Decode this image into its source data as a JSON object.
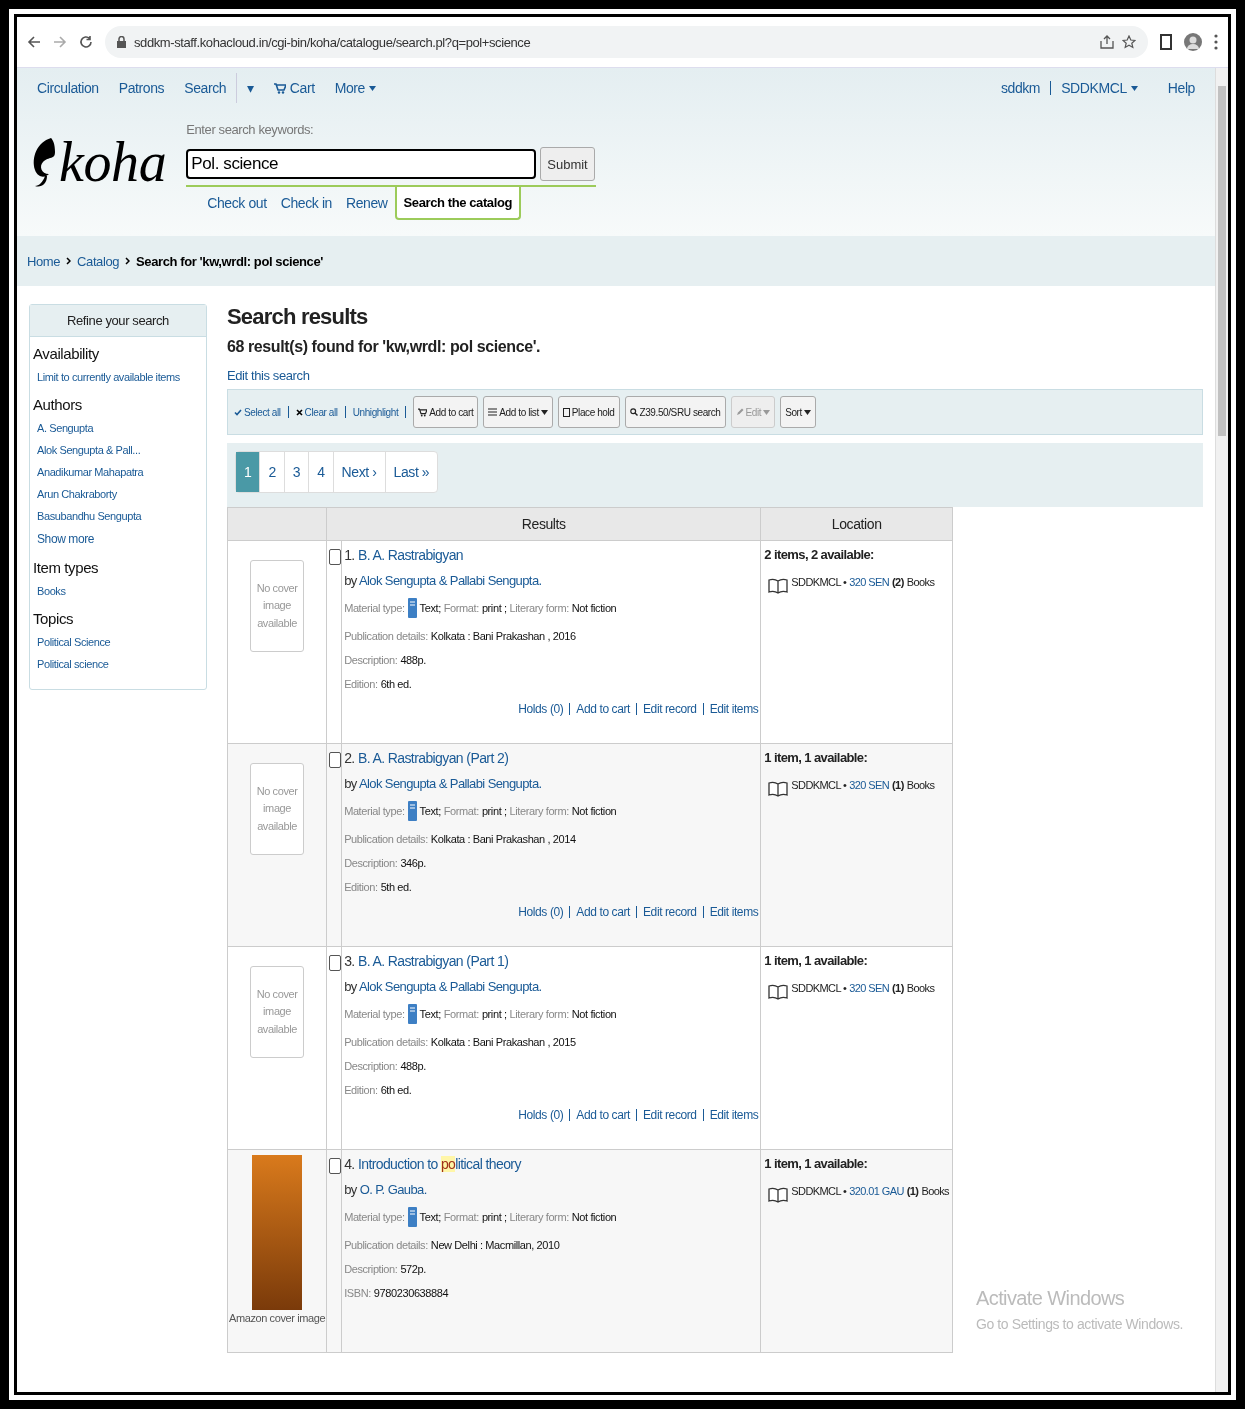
{
  "browser": {
    "url": "sddkm-staff.kohacloud.in/cgi-bin/koha/catalogue/search.pl?q=pol+science"
  },
  "nav": {
    "left": [
      {
        "label": "Circulation",
        "kind": "link"
      },
      {
        "label": "Patrons",
        "kind": "link"
      },
      {
        "label": "Search",
        "kind": "link"
      },
      {
        "label": "▾",
        "kind": "toggle"
      },
      {
        "label": "Cart",
        "kind": "cart"
      },
      {
        "label": "More",
        "kind": "menu"
      }
    ],
    "right": [
      {
        "label": "sddkm",
        "kind": "link"
      },
      {
        "label": "SDDKMCL",
        "kind": "menu"
      },
      {
        "label": "Help",
        "kind": "link"
      }
    ]
  },
  "header": {
    "logo": "koha",
    "search_label": "Enter search keywords:",
    "search_value": "Pol. science",
    "submit": "Submit",
    "tabs": [
      {
        "label": "Check out",
        "selected": false
      },
      {
        "label": "Check in",
        "selected": false
      },
      {
        "label": "Renew",
        "selected": false
      },
      {
        "label": "Search the catalog",
        "selected": true
      }
    ]
  },
  "breadcrumb": [
    {
      "label": "Home",
      "link": true
    },
    {
      "label": "Catalog",
      "link": true
    },
    {
      "label": "Search for 'kw,wrdl: pol science'",
      "link": false
    }
  ],
  "sidebar": {
    "title": "Refine your search",
    "groups": [
      {
        "heading": "Availability",
        "items": [
          {
            "label": "Limit to currently available items",
            "kind": "link"
          }
        ]
      },
      {
        "heading": "Authors",
        "items": [
          {
            "label": "A. Sengupta",
            "kind": "link"
          },
          {
            "label": "Alok Sengupta & Pall...",
            "kind": "link"
          },
          {
            "label": "Anadikumar Mahapatra",
            "kind": "link"
          },
          {
            "label": "Arun Chakraborty",
            "kind": "link"
          },
          {
            "label": "Basubandhu Sengupta",
            "kind": "link"
          },
          {
            "label": "Show more",
            "kind": "more"
          }
        ]
      },
      {
        "heading": "Item types",
        "items": [
          {
            "label": "Books",
            "kind": "link"
          }
        ]
      },
      {
        "heading": "Topics",
        "items": [
          {
            "label": "Political Science",
            "kind": "link"
          },
          {
            "label": "Political science",
            "kind": "link"
          }
        ]
      }
    ]
  },
  "main": {
    "title": "Search results",
    "summary": "68 result(s) found for 'kw,wrdl: pol science'.",
    "edit_link": "Edit this search"
  },
  "toolbar": {
    "links": [
      {
        "label": "Select all",
        "kind": "check"
      },
      {
        "label": "Clear all",
        "kind": "cross"
      },
      {
        "label": "Unhighlight",
        "kind": "plain"
      }
    ],
    "buttons": [
      {
        "label": "Add to cart",
        "kind": "cart",
        "caret": false,
        "disabled": false
      },
      {
        "label": "Add to list",
        "kind": "list",
        "caret": true,
        "disabled": false
      },
      {
        "label": "Place hold",
        "kind": "doc",
        "caret": false,
        "disabled": false
      },
      {
        "label": "Z39.50/SRU search",
        "kind": "search",
        "caret": false,
        "disabled": false
      },
      {
        "label": "Edit",
        "kind": "pencil",
        "caret": true,
        "disabled": true
      },
      {
        "label": "Sort",
        "kind": "plain",
        "caret": true,
        "disabled": false
      }
    ]
  },
  "pagination": [
    {
      "label": "1",
      "selected": true
    },
    {
      "label": "2",
      "selected": false
    },
    {
      "label": "3",
      "selected": false
    },
    {
      "label": "4",
      "selected": false
    },
    {
      "label": "Next ›",
      "selected": false
    },
    {
      "label": "Last »",
      "selected": false
    }
  ],
  "table": {
    "columns": [
      "Results",
      "Location"
    ],
    "rows": [
      {
        "cover": {
          "kind": "none",
          "text": "No cover image available"
        },
        "checked": false,
        "number": "1.",
        "title": [
          {
            "text": "B. A. Rastrabigyan",
            "highlight": false
          }
        ],
        "by": "by",
        "author": "Alok Sengupta & Pallabi Sengupta.",
        "details": [
          [
            {
              "label": "Material type:",
              "value": "Text;",
              "kind": "material"
            },
            {
              "label": "Format:",
              "value": "print ;",
              "kind": "plain"
            },
            {
              "label": "Literary form:",
              "value": "Not fiction",
              "kind": "plain"
            }
          ],
          [
            {
              "label": "Publication details:",
              "value": "Kolkata : Bani Prakashan , 2016",
              "kind": "plain"
            }
          ],
          [
            {
              "label": "Description:",
              "value": "488p.",
              "kind": "plain"
            }
          ],
          [
            {
              "label": "Edition:",
              "value": "6th ed.",
              "kind": "plain"
            }
          ]
        ],
        "actions": [
          "Holds (0)",
          "Add to cart",
          "Edit record",
          "Edit items"
        ],
        "availability": "2 items, 2 available:",
        "holdings": [
          {
            "library": "SDDKMCL •",
            "callnumber": "320 SEN",
            "count": "(2)",
            "type": "Books"
          }
        ]
      },
      {
        "cover": {
          "kind": "none",
          "text": "No cover image available"
        },
        "checked": false,
        "number": "2.",
        "title": [
          {
            "text": "B. A. Rastrabigyan (Part 2)",
            "highlight": false
          }
        ],
        "by": "by",
        "author": "Alok Sengupta & Pallabi Sengupta.",
        "details": [
          [
            {
              "label": "Material type:",
              "value": "Text;",
              "kind": "material"
            },
            {
              "label": "Format:",
              "value": "print ;",
              "kind": "plain"
            },
            {
              "label": "Literary form:",
              "value": "Not fiction",
              "kind": "plain"
            }
          ],
          [
            {
              "label": "Publication details:",
              "value": "Kolkata : Bani Prakashan , 2014",
              "kind": "plain"
            }
          ],
          [
            {
              "label": "Description:",
              "value": "346p.",
              "kind": "plain"
            }
          ],
          [
            {
              "label": "Edition:",
              "value": "5th ed.",
              "kind": "plain"
            }
          ]
        ],
        "actions": [
          "Holds (0)",
          "Add to cart",
          "Edit record",
          "Edit items"
        ],
        "availability": "1 item, 1 available:",
        "holdings": [
          {
            "library": "SDDKMCL •",
            "callnumber": "320 SEN",
            "count": "(1)",
            "type": "Books"
          }
        ]
      },
      {
        "cover": {
          "kind": "none",
          "text": "No cover image available"
        },
        "checked": false,
        "number": "3.",
        "title": [
          {
            "text": "B. A. Rastrabigyan (Part 1)",
            "highlight": false
          }
        ],
        "by": "by",
        "author": "Alok Sengupta & Pallabi Sengupta.",
        "details": [
          [
            {
              "label": "Material type:",
              "value": "Text;",
              "kind": "material"
            },
            {
              "label": "Format:",
              "value": "print ;",
              "kind": "plain"
            },
            {
              "label": "Literary form:",
              "value": "Not fiction",
              "kind": "plain"
            }
          ],
          [
            {
              "label": "Publication details:",
              "value": "Kolkata : Bani Prakashan , 2015",
              "kind": "plain"
            }
          ],
          [
            {
              "label": "Description:",
              "value": "488p.",
              "kind": "plain"
            }
          ],
          [
            {
              "label": "Edition:",
              "value": "6th ed.",
              "kind": "plain"
            }
          ]
        ],
        "actions": [
          "Holds (0)",
          "Add to cart",
          "Edit record",
          "Edit items"
        ],
        "availability": "1 item, 1 available:",
        "holdings": [
          {
            "library": "SDDKMCL •",
            "callnumber": "320 SEN",
            "count": "(1)",
            "type": "Books"
          }
        ]
      },
      {
        "cover": {
          "kind": "image",
          "text": "Amazon cover image"
        },
        "checked": false,
        "number": "4.",
        "title": [
          {
            "text": "Introduction to ",
            "highlight": false
          },
          {
            "text": "po",
            "highlight": true
          },
          {
            "text": "litical theory",
            "highlight": false
          }
        ],
        "by": "by",
        "author": "O. P. Gauba.",
        "details": [
          [
            {
              "label": "Material type:",
              "value": "Text;",
              "kind": "material"
            },
            {
              "label": "Format:",
              "value": "print ;",
              "kind": "plain"
            },
            {
              "label": "Literary form:",
              "value": "Not fiction",
              "kind": "plain"
            }
          ],
          [
            {
              "label": "Publication details:",
              "value": "New Delhi : Macmillan, 2010",
              "kind": "plain"
            }
          ],
          [
            {
              "label": "Description:",
              "value": "572p.",
              "kind": "plain"
            }
          ],
          [
            {
              "label": "ISBN:",
              "value": "9780230638884",
              "kind": "plain"
            }
          ]
        ],
        "actions": [],
        "availability": "1 item, 1 available:",
        "holdings": [
          {
            "library": "SDDKMCL •",
            "callnumber": "320.01 GAU",
            "count": "(1)",
            "type": "Books"
          }
        ]
      }
    ]
  },
  "os_overlay": {
    "title": "Activate Windows",
    "subtitle": "Go to Settings to activate Windows."
  }
}
